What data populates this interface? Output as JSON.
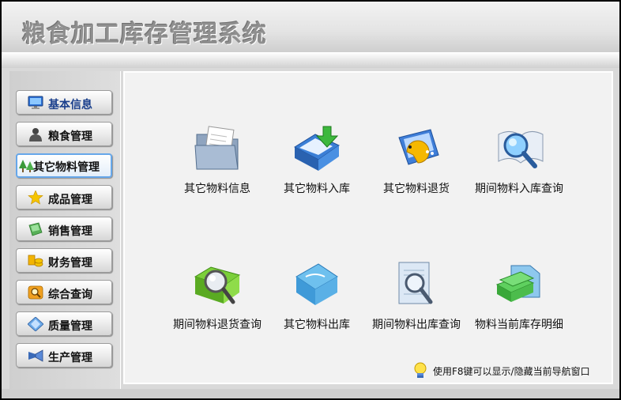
{
  "app": {
    "title": "粮食加工库存管理系统"
  },
  "sidebar": {
    "items": [
      {
        "label": "基本信息",
        "icon": "monitor-icon"
      },
      {
        "label": "粮食管理",
        "icon": "person-icon"
      },
      {
        "label": "其它物料管理",
        "icon": "trees-icon",
        "active": true
      },
      {
        "label": "成品管理",
        "icon": "star-icon"
      },
      {
        "label": "销售管理",
        "icon": "note-icon"
      },
      {
        "label": "财务管理",
        "icon": "coins-icon"
      },
      {
        "label": "综合查询",
        "icon": "search-box-icon"
      },
      {
        "label": "质量管理",
        "icon": "diamond-icon"
      },
      {
        "label": "生产管理",
        "icon": "trumpet-icon"
      }
    ]
  },
  "main": {
    "tiles": [
      {
        "label": "其它物料信息",
        "icon": "folder-document-icon"
      },
      {
        "label": "其它物料入库",
        "icon": "inbox-arrow-icon"
      },
      {
        "label": "其它物料退货",
        "icon": "pacman-folder-icon"
      },
      {
        "label": "期间物料入库查询",
        "icon": "magnifier-book-icon"
      },
      {
        "label": "期间物料退货查询",
        "icon": "magnifier-box-icon"
      },
      {
        "label": "其它物料出库",
        "icon": "blue-folder-icon"
      },
      {
        "label": "期间物料出库查询",
        "icon": "magnifier-page-icon"
      },
      {
        "label": "物料当前库存明细",
        "icon": "green-books-icon"
      }
    ]
  },
  "hint": {
    "text": "使用F8键可以显示/隐藏当前导航窗口",
    "icon": "lightbulb-icon"
  },
  "colors": {
    "active_border": "#66a7ea",
    "first_label": "#1a3f8c"
  }
}
